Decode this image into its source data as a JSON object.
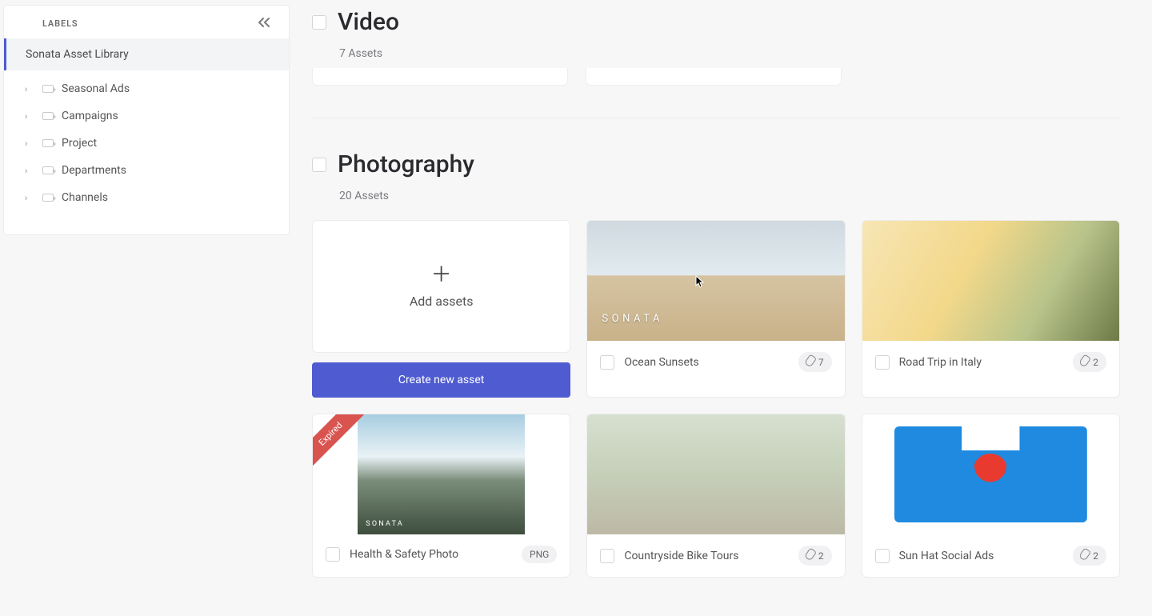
{
  "sidebar": {
    "header": "LABELS",
    "library": "Sonata Asset Library",
    "items": [
      {
        "label": "Seasonal Ads"
      },
      {
        "label": "Campaigns"
      },
      {
        "label": "Project"
      },
      {
        "label": "Departments"
      },
      {
        "label": "Channels"
      }
    ]
  },
  "sections": {
    "video": {
      "title": "Video",
      "count": "7 Assets"
    },
    "photography": {
      "title": "Photography",
      "count": "20 Assets"
    }
  },
  "add_card_label": "Add assets",
  "create_button": "Create new asset",
  "assets": {
    "ocean": {
      "title": "Ocean Sunsets",
      "badge": "7",
      "overlay": "SONATA"
    },
    "roadtrip": {
      "title": "Road Trip in Italy",
      "badge": "2"
    },
    "health": {
      "title": "Health & Safety Photo",
      "badge": "PNG",
      "ribbon": "Expired",
      "overlay": "SONATA"
    },
    "bike": {
      "title": "Countryside Bike Tours",
      "badge": "2"
    },
    "sunhat": {
      "title": "Sun Hat Social Ads",
      "badge": "2"
    }
  }
}
